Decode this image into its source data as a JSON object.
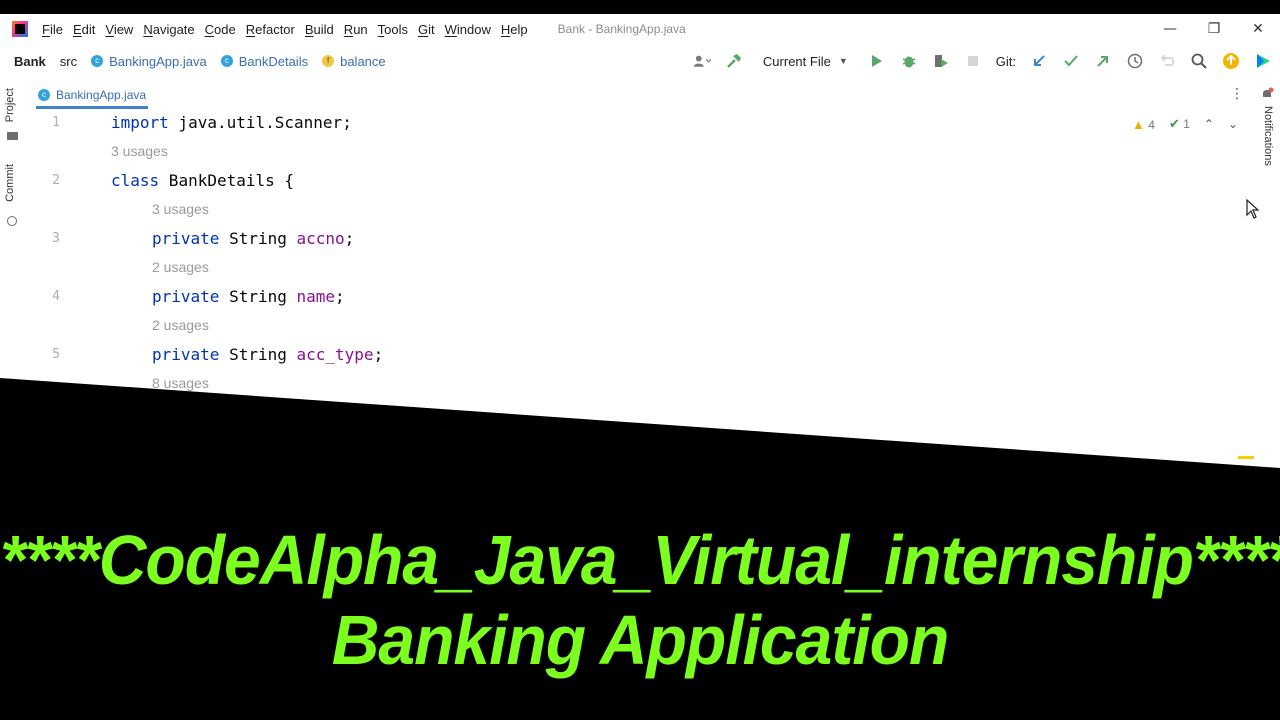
{
  "menubar": {
    "items": [
      "File",
      "Edit",
      "View",
      "Navigate",
      "Code",
      "Refactor",
      "Build",
      "Run",
      "Tools",
      "Git",
      "Window",
      "Help"
    ],
    "window_title": "Bank - BankingApp.java",
    "controls": {
      "minimize": "—",
      "restore": "❐",
      "close": "✕"
    }
  },
  "navbar": {
    "project": "Bank",
    "src": "src",
    "file": "BankingApp.java",
    "class": "BankDetails",
    "field": "balance",
    "class_icon_glyph": "c",
    "field_icon_glyph": "f",
    "run_config": "Current File",
    "git_label": "Git:"
  },
  "sidebar": {
    "project": "Project",
    "commit": "Commit",
    "notifications": "Notifications"
  },
  "editor": {
    "tab": "BankingApp.java",
    "inspections": {
      "warnings": "4",
      "ok": "1"
    },
    "lines": [
      {
        "num": "1",
        "usage": "",
        "indent": 0,
        "tokens": [
          {
            "t": "import",
            "c": "kw"
          },
          {
            "t": " java.util.Scanner;",
            "c": ""
          }
        ]
      },
      {
        "num": "",
        "usage": "3 usages",
        "indent": 0
      },
      {
        "num": "2",
        "indent": 0,
        "tokens": [
          {
            "t": "class",
            "c": "kw"
          },
          {
            "t": " BankDetails {",
            "c": ""
          }
        ]
      },
      {
        "num": "",
        "usage": "3 usages",
        "indent": 1
      },
      {
        "num": "3",
        "indent": 1,
        "tokens": [
          {
            "t": "private",
            "c": "kw"
          },
          {
            "t": " String ",
            "c": ""
          },
          {
            "t": "accno",
            "c": "fld"
          },
          {
            "t": ";",
            "c": ""
          }
        ]
      },
      {
        "num": "",
        "usage": "2 usages",
        "indent": 1
      },
      {
        "num": "4",
        "indent": 1,
        "tokens": [
          {
            "t": "private",
            "c": "kw"
          },
          {
            "t": " String ",
            "c": ""
          },
          {
            "t": "name",
            "c": "fld"
          },
          {
            "t": ";",
            "c": ""
          }
        ]
      },
      {
        "num": "",
        "usage": "2 usages",
        "indent": 1
      },
      {
        "num": "5",
        "indent": 1,
        "tokens": [
          {
            "t": "private",
            "c": "kw"
          },
          {
            "t": " String ",
            "c": ""
          },
          {
            "t": "acc_type",
            "c": "fld"
          },
          {
            "t": ";",
            "c": ""
          }
        ]
      },
      {
        "num": "",
        "usage": "8 usages",
        "indent": 1
      }
    ]
  },
  "banner": {
    "line1": "****CodeAlpha_Java_Virtual_internship****",
    "line2": "Banking Application"
  },
  "colors": {
    "banner": "#7cff1f",
    "keyword": "#0033b3",
    "field": "#871094",
    "usage": "#9a9a9a",
    "link": "#3b6db5"
  }
}
